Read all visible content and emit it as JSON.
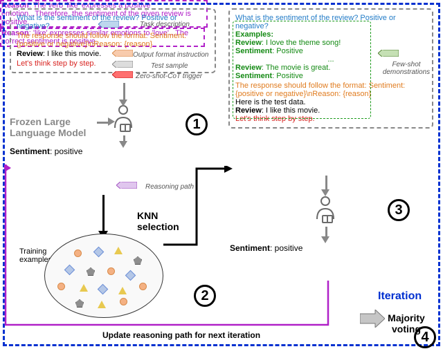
{
  "panel1": {
    "task": "What is the sentiment of the review? Positive or negative?",
    "task_label": "Task description",
    "format": "The response should follow the format: Sentiment: {positive or negative}\\nReason: {reason}",
    "format_label": "Output format instruction",
    "review_key": "Review",
    "review_text": ": I like this movie.",
    "sample_label": "Test sample",
    "cot": "Let's think step by step.",
    "cot_label": "Zero-shot-CoT trigger"
  },
  "panel2": {
    "task": "What is the sentiment of the review? Positive or negative?",
    "ex_header": "Examples:",
    "r1k": "Review",
    "r1v": ": I love the theme song!",
    "s1k": "Sentiment",
    "s1v": ": Positive",
    "dots": "...",
    "r2k": "Review",
    "r2v": ": The movie is great.",
    "s2k": "Sentiment",
    "s2v": ": Positive",
    "fs_label": "Few-shot demonstrations",
    "format": "The response should follow the format: Sentiment: {positive or negative}\\nReason: {reason}",
    "here": "Here is the test data.",
    "review_key": "Review",
    "review_text": ": I like this movie.",
    "cot": "Let's think step by step."
  },
  "output1": {
    "sk": "Sentiment",
    "sv": ": positive",
    "rk": "Reason",
    "rv": ": The verb 'like' expresses a positive emotion...Therefore, the sentiment of the given review is positive.",
    "rlabel": "Reasoning path"
  },
  "output2": {
    "sk": "Sentiment",
    "sv": ": positive",
    "rk": "Reason",
    "rv": ": 'like' expresses similar emotions to 'love'...The correct sentiment is positive."
  },
  "labels": {
    "fllm": "Frozen Large Language Model",
    "knn1": "KNN",
    "knn2": "selection",
    "iter": "Iteration",
    "mv1": "Majority",
    "mv2": "voting",
    "update_a": "Update reasoning path for ",
    "update_b": "next iteration",
    "train": "Training examples"
  },
  "circles": {
    "c1": "1",
    "c2": "2",
    "c3": "3",
    "c4": "4"
  }
}
